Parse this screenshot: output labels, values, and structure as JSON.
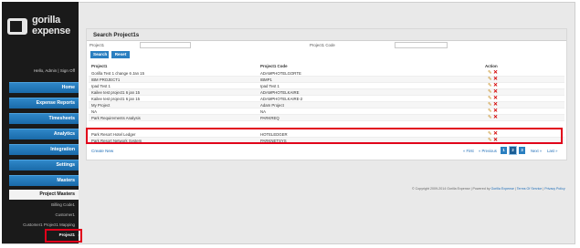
{
  "brand": {
    "line1": "gorilla",
    "line2": "expense"
  },
  "user": {
    "greeting": "Hello, Admin | Sign Off"
  },
  "nav": [
    {
      "label": "Home"
    },
    {
      "label": "Expense Reports"
    },
    {
      "label": "Timesheets"
    },
    {
      "label": "Analytics"
    },
    {
      "label": "Integration"
    },
    {
      "label": "Settings"
    },
    {
      "label": "Masters"
    }
  ],
  "masters": {
    "active_label": "Project Masters",
    "sub_items": [
      "Billing Code1",
      "Customer1",
      "Customer1 Project1 Mapping",
      "Project1"
    ],
    "selected": "Project1"
  },
  "search": {
    "title": "Search Project1s",
    "project_label": "Project1",
    "code_label": "Project1 Code",
    "project_value": "",
    "code_value": "",
    "search_button": "Search",
    "reset_button": "Reset"
  },
  "table": {
    "headers": [
      "Project1",
      "Project1 Code",
      "Action"
    ],
    "rows": [
      [
        "Gorilla Test 1 change 6 Jan 15",
        "ADAMPHOTELGORTE"
      ],
      [
        "IBM PROJECT1",
        "IBMP1"
      ],
      [
        "Ipad Test 1",
        "Ipad Test 1"
      ],
      [
        "Kailee test project1 6 jan 15",
        "ADAMPHOTELKAIRE"
      ],
      [
        "Kailee test project1 6 jan 15",
        "ADAMPHOTELKAIRE-2"
      ],
      [
        "My Project",
        "Adam Project"
      ],
      [
        "NA",
        "NA"
      ],
      [
        "Park Requirements Analysis",
        "PARKREQ"
      ],
      [
        "Park Resort Hotel Ledger",
        "HOTELEDGER"
      ],
      [
        "Park Resort Network System",
        "PARKNETSYS"
      ]
    ]
  },
  "actions": {
    "edit_icon": "pencil-icon",
    "delete_icon": "x-icon"
  },
  "pagination": {
    "first": "« First",
    "previous": "« Previous",
    "pages": [
      "1",
      "2",
      "3"
    ],
    "current_page": "2",
    "next": "Next »",
    "last": "Last »"
  },
  "create_new": "Create New",
  "footer": {
    "copyright": "© Copyright 2009-2014 Gorilla Expense | Powered by",
    "powered_by": "Gorilla Expense",
    "terms": "Terms Of Service",
    "privacy": "Privacy Policy"
  },
  "colors": {
    "accent": "#2a7fc0",
    "highlight": "#e1001a",
    "sidebar": "#1a1a1a"
  }
}
